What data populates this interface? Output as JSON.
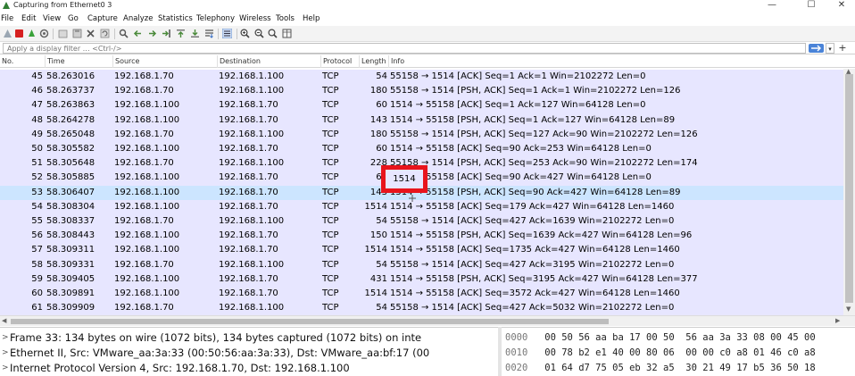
{
  "window": {
    "title": "Capturing from Ethernet0 3",
    "minimize_glyph": "—",
    "maximize_glyph": "☐",
    "close_glyph": "✕"
  },
  "menu": [
    "File",
    "Edit",
    "View",
    "Go",
    "Capture",
    "Analyze",
    "Statistics",
    "Telephony",
    "Wireless",
    "Tools",
    "Help"
  ],
  "toolbar_icons": [
    "shark-fin-start-icon",
    "stop-icon",
    "restart-icon",
    "capture-options-icon",
    "open-file-icon",
    "save-file-icon",
    "close-file-icon",
    "reload-icon",
    "find-icon",
    "go-back-icon",
    "go-forward-icon",
    "go-to-packet-icon",
    "first-packet-icon",
    "last-packet-icon",
    "autoscroll-icon",
    "colorize-icon",
    "zoom-in-icon",
    "zoom-out-icon",
    "zoom-normal-icon",
    "resize-columns-icon"
  ],
  "filter": {
    "placeholder": "Apply a display filter … <Ctrl-/>",
    "add_glyph": "+",
    "drop_glyph": "▾"
  },
  "columns": [
    "No.",
    "Time",
    "Source",
    "Destination",
    "Protocol",
    "Length",
    "Info"
  ],
  "packets": [
    {
      "no": "45",
      "time": "58.263016",
      "src": "192.168.1.70",
      "dst": "192.168.1.100",
      "proto": "TCP",
      "len": "54",
      "info": "55158 → 1514 [ACK] Seq=1 Ack=1 Win=2102272 Len=0"
    },
    {
      "no": "46",
      "time": "58.263737",
      "src": "192.168.1.70",
      "dst": "192.168.1.100",
      "proto": "TCP",
      "len": "180",
      "info": "55158 → 1514 [PSH, ACK] Seq=1 Ack=1 Win=2102272 Len=126"
    },
    {
      "no": "47",
      "time": "58.263863",
      "src": "192.168.1.100",
      "dst": "192.168.1.70",
      "proto": "TCP",
      "len": "60",
      "info": "1514 → 55158 [ACK] Seq=1 Ack=127 Win=64128 Len=0"
    },
    {
      "no": "48",
      "time": "58.264278",
      "src": "192.168.1.100",
      "dst": "192.168.1.70",
      "proto": "TCP",
      "len": "143",
      "info": "1514 → 55158 [PSH, ACK] Seq=1 Ack=127 Win=64128 Len=89"
    },
    {
      "no": "49",
      "time": "58.265048",
      "src": "192.168.1.70",
      "dst": "192.168.1.100",
      "proto": "TCP",
      "len": "180",
      "info": "55158 → 1514 [PSH, ACK] Seq=127 Ack=90 Win=2102272 Len=126"
    },
    {
      "no": "50",
      "time": "58.305582",
      "src": "192.168.1.100",
      "dst": "192.168.1.70",
      "proto": "TCP",
      "len": "60",
      "info": "1514 → 55158 [ACK] Seq=90 Ack=253 Win=64128 Len=0"
    },
    {
      "no": "51",
      "time": "58.305648",
      "src": "192.168.1.70",
      "dst": "192.168.1.100",
      "proto": "TCP",
      "len": "228",
      "info": "55158 → 1514 [PSH, ACK] Seq=253 Ack=90 Win=2102272 Len=174"
    },
    {
      "no": "52",
      "time": "58.305885",
      "src": "192.168.1.100",
      "dst": "192.168.1.70",
      "proto": "TCP",
      "len": "60",
      "info": "1514 → 55158 [ACK] Seq=90 Ack=427 Win=64128 Len=0"
    },
    {
      "no": "53",
      "time": "58.306407",
      "src": "192.168.1.100",
      "dst": "192.168.1.70",
      "proto": "TCP",
      "len": "143",
      "info": "1514 → 55158 [PSH, ACK] Seq=90 Ack=427 Win=64128 Len=89"
    },
    {
      "no": "54",
      "time": "58.308304",
      "src": "192.168.1.100",
      "dst": "192.168.1.70",
      "proto": "TCP",
      "len": "1514",
      "info": "1514 → 55158 [ACK] Seq=179 Ack=427 Win=64128 Len=1460"
    },
    {
      "no": "55",
      "time": "58.308337",
      "src": "192.168.1.70",
      "dst": "192.168.1.100",
      "proto": "TCP",
      "len": "54",
      "info": "55158 → 1514 [ACK] Seq=427 Ack=1639 Win=2102272 Len=0"
    },
    {
      "no": "56",
      "time": "58.308443",
      "src": "192.168.1.100",
      "dst": "192.168.1.70",
      "proto": "TCP",
      "len": "150",
      "info": "1514 → 55158 [PSH, ACK] Seq=1639 Ack=427 Win=64128 Len=96"
    },
    {
      "no": "57",
      "time": "58.309311",
      "src": "192.168.1.100",
      "dst": "192.168.1.70",
      "proto": "TCP",
      "len": "1514",
      "info": "1514 → 55158 [ACK] Seq=1735 Ack=427 Win=64128 Len=1460"
    },
    {
      "no": "58",
      "time": "58.309331",
      "src": "192.168.1.70",
      "dst": "192.168.1.100",
      "proto": "TCP",
      "len": "54",
      "info": "55158 → 1514 [ACK] Seq=427 Ack=3195 Win=2102272 Len=0"
    },
    {
      "no": "59",
      "time": "58.309405",
      "src": "192.168.1.100",
      "dst": "192.168.1.70",
      "proto": "TCP",
      "len": "431",
      "info": "1514 → 55158 [PSH, ACK] Seq=3195 Ack=427 Win=64128 Len=377"
    },
    {
      "no": "60",
      "time": "58.309891",
      "src": "192.168.1.100",
      "dst": "192.168.1.70",
      "proto": "TCP",
      "len": "1514",
      "info": "1514 → 55158 [ACK] Seq=3572 Ack=427 Win=64128 Len=1460"
    },
    {
      "no": "61",
      "time": "58.309909",
      "src": "192.168.1.70",
      "dst": "192.168.1.100",
      "proto": "TCP",
      "len": "54",
      "info": "55158 → 1514 [ACK] Seq=427 Ack=5032 Win=2102272 Len=0"
    }
  ],
  "selected_row": "53",
  "highlight_label": "1514",
  "details": [
    "Frame 33: 134 bytes on wire (1072 bits), 134 bytes captured (1072 bits) on inte",
    "Ethernet II, Src: VMware_aa:3a:33 (00:50:56:aa:3a:33), Dst: VMware_aa:bf:17 (00",
    "Internet Protocol Version 4, Src: 192.168.1.70, Dst: 192.168.1.100"
  ],
  "details_twisty": ">",
  "bytes": [
    {
      "off": "0000",
      "hex": "00 50 56 aa ba 17 00 50  56 aa 3a 33 08 00 45 00"
    },
    {
      "off": "0010",
      "hex": "00 78 b2 e1 40 00 80 06  00 00 c0 a8 01 46 c0 a8"
    },
    {
      "off": "0020",
      "hex": "01 64 d7 75 05 eb 32 a5  30 21 49 17 b5 36 50 18"
    }
  ],
  "colors": {
    "row_bg": "#e7e6ff",
    "selected_bg": "#cce5ff",
    "highlight": "#e8141c",
    "apply_button": "#4b84d8"
  }
}
